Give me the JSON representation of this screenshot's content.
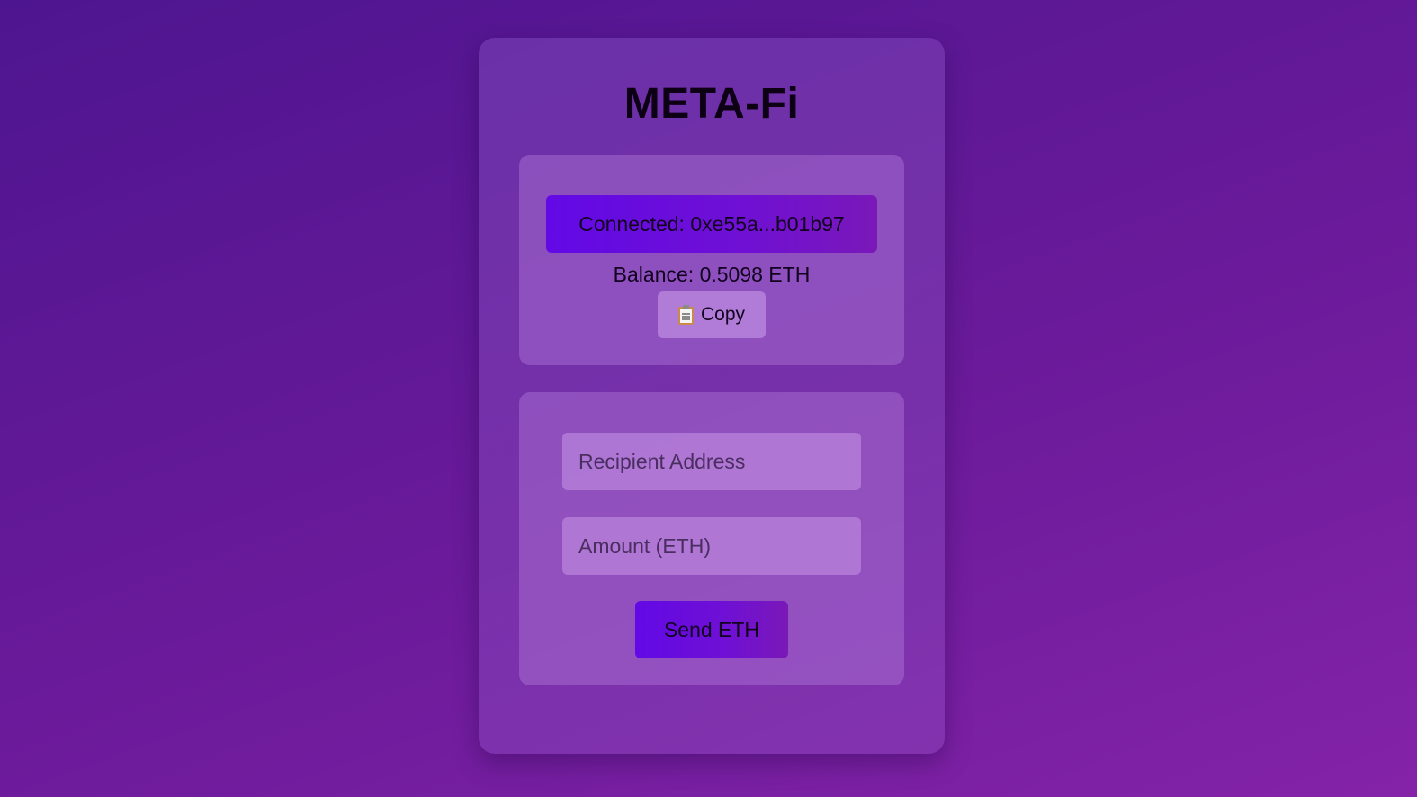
{
  "app": {
    "title": "META-Fi"
  },
  "wallet": {
    "connected_label": "Connected: 0xe55a...b01b97",
    "balance_text": "Balance: 0.5098 ETH",
    "copy_button": {
      "icon": "clipboard-icon",
      "label": "Copy"
    }
  },
  "send_form": {
    "recipient": {
      "value": "",
      "placeholder": "Recipient Address"
    },
    "amount": {
      "value": "",
      "placeholder": "Amount (ETH)"
    },
    "send_label": "Send ETH"
  },
  "colors": {
    "accent": "#6209e6",
    "background": "#5a1896"
  }
}
